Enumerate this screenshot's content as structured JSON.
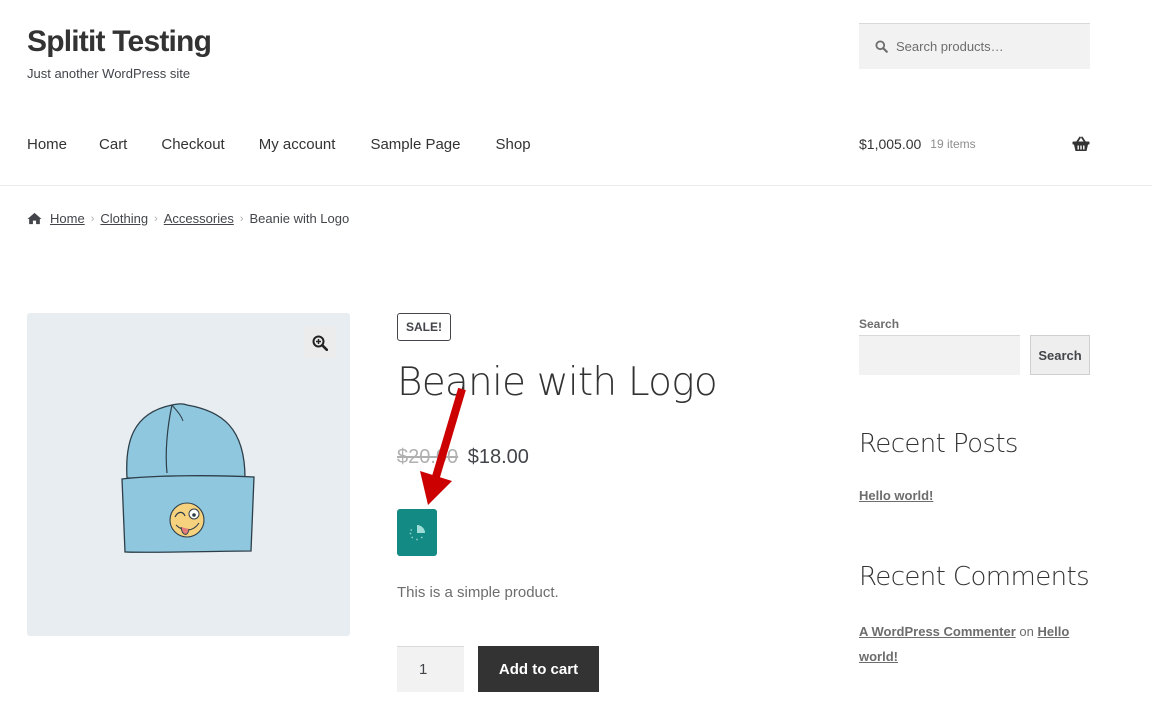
{
  "site": {
    "title": "Splitit Testing",
    "tagline": "Just another WordPress site"
  },
  "header_search": {
    "placeholder": "Search products…",
    "icon": "search-icon"
  },
  "nav": {
    "items": [
      {
        "label": "Home"
      },
      {
        "label": "Cart"
      },
      {
        "label": "Checkout"
      },
      {
        "label": "My account"
      },
      {
        "label": "Sample Page"
      },
      {
        "label": "Shop"
      }
    ]
  },
  "cart": {
    "amount": "$1,005.00",
    "count": "19 items",
    "icon": "basket-icon"
  },
  "breadcrumb": {
    "icon": "home-icon",
    "items": [
      {
        "label": "Home",
        "link": true
      },
      {
        "label": "Clothing",
        "link": true
      },
      {
        "label": "Accessories",
        "link": true
      },
      {
        "label": "Beanie with Logo",
        "link": false
      }
    ]
  },
  "product": {
    "sale_badge": "SALE!",
    "title": "Beanie with Logo",
    "regular_price": "$20.00",
    "sale_price": "$18.00",
    "short_description": "This is a simple product.",
    "quantity": "1",
    "add_to_cart_label": "Add to cart",
    "splitit_button_icon": "loading-spinner-icon",
    "image_zoom_icon": "zoom-in-icon",
    "accent_color": "#138a83"
  },
  "annotation": {
    "arrow_color": "#cc0000"
  },
  "sidebar": {
    "search_label": "Search",
    "search_button": "Search",
    "recent_posts_title": "Recent Posts",
    "recent_posts": [
      {
        "label": "Hello world!"
      }
    ],
    "recent_comments_title": "Recent Comments",
    "recent_comments": [
      {
        "author": "A WordPress Commenter",
        "connector": "on",
        "post": "Hello world!"
      }
    ]
  }
}
